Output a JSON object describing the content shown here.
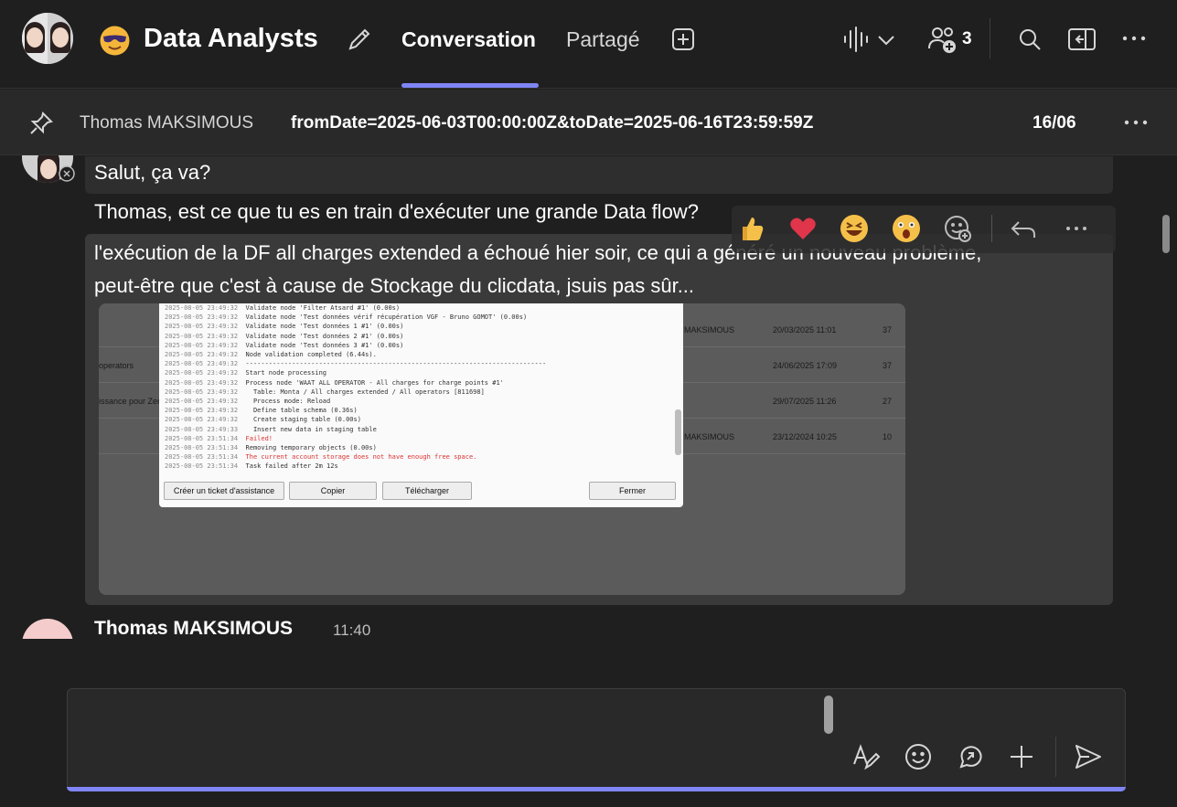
{
  "header": {
    "title": "Data Analysts",
    "tabs": [
      {
        "label": "Conversation",
        "active": true
      },
      {
        "label": "Partagé",
        "active": false
      }
    ],
    "participant_count": "3",
    "accent_color": "#7f85f5"
  },
  "pinned": {
    "author": "Thomas MAKSIMOUS",
    "text": "fromDate=2025-06-03T00:00:00Z&toDate=2025-06-16T23:59:59Z",
    "date": "16/06"
  },
  "messages": [
    {
      "text": "Salut, ça va?"
    },
    {
      "text": "Thomas, est ce que tu es en train d'exécuter une grande Data flow?"
    },
    {
      "lines": [
        "l'exécution de la DF all charges extended a échoué hier soir, ce qui a généré un nouveau problème,",
        "peut-être que c'est à cause de Stockage du clicdata, jsuis pas sûr..."
      ]
    }
  ],
  "reactions": [
    "thumbs-up",
    "heart",
    "laughing",
    "surprised",
    "add-reaction",
    "reply",
    "more"
  ],
  "embedded_screenshot": {
    "background_rows": [
      {
        "left": "MAKSIMOUS",
        "date": "20/03/2025 11:01",
        "count": "37"
      },
      {
        "left": "operators",
        "date": "24/06/2025 17:09",
        "count": "37"
      },
      {
        "left": "issance pour Zen",
        "date": "29/07/2025 11:26",
        "count": "27"
      },
      {
        "left": "MAKSIMOUS",
        "date": "23/12/2024 10:25",
        "count": "10"
      }
    ],
    "log_lines": [
      {
        "ts": "2025-08-05 23:49:32",
        "msg": "Validate node 'Filter Atsard #1' (0.00s)",
        "error": false
      },
      {
        "ts": "2025-08-05 23:49:32",
        "msg": "Validate node 'Test données vérif récupération VGF - Bruno GOMOT' (0.00s)",
        "error": false
      },
      {
        "ts": "2025-08-05 23:49:32",
        "msg": "Validate node 'Test données 1 #1' (0.00s)",
        "error": false
      },
      {
        "ts": "2025-08-05 23:49:32",
        "msg": "Validate node 'Test données 2 #1' (0.00s)",
        "error": false
      },
      {
        "ts": "2025-08-05 23:49:32",
        "msg": "Validate node 'Test données 3 #1' (0.00s)",
        "error": false
      },
      {
        "ts": "2025-08-05 23:49:32",
        "msg": "Node validation completed (6.44s).",
        "error": false
      },
      {
        "ts": "2025-08-05 23:49:32",
        "msg": "------------------------------------------------------------------------------",
        "error": false
      },
      {
        "ts": "2025-08-05 23:49:32",
        "msg": "Start node processing",
        "error": false
      },
      {
        "ts": "2025-08-05 23:49:32",
        "msg": "Process node 'WAAT ALL OPERATOR - All charges for charge points #1'",
        "error": false
      },
      {
        "ts": "2025-08-05 23:49:32",
        "msg": "  Table: Monta / All charges extended / All operators [811698]",
        "error": false
      },
      {
        "ts": "2025-08-05 23:49:32",
        "msg": "  Process mode: Reload",
        "error": false
      },
      {
        "ts": "2025-08-05 23:49:32",
        "msg": "  Define table schema (0.36s)",
        "error": false
      },
      {
        "ts": "2025-08-05 23:49:32",
        "msg": "  Create staging table (0.00s)",
        "error": false
      },
      {
        "ts": "2025-08-05 23:49:33",
        "msg": "  Insert new data in staging table",
        "error": false
      },
      {
        "ts": "2025-08-05 23:51:34",
        "msg": "Failed!",
        "error": true
      },
      {
        "ts": "2025-08-05 23:51:34",
        "msg": "Removing temporary objects (0.00s)",
        "error": false
      },
      {
        "ts": "2025-08-05 23:51:34",
        "msg": "The current account storage does not have enough free space.",
        "error": true
      },
      {
        "ts": "2025-08-05 23:51:34",
        "msg": "Task failed after 2m 12s",
        "error": false
      }
    ],
    "buttons": {
      "ticket": "Créer un ticket d'assistance",
      "copy": "Copier",
      "download": "Télécharger",
      "close": "Fermer"
    }
  },
  "next_message": {
    "author": "Thomas MAKSIMOUS",
    "time": "11:40"
  }
}
